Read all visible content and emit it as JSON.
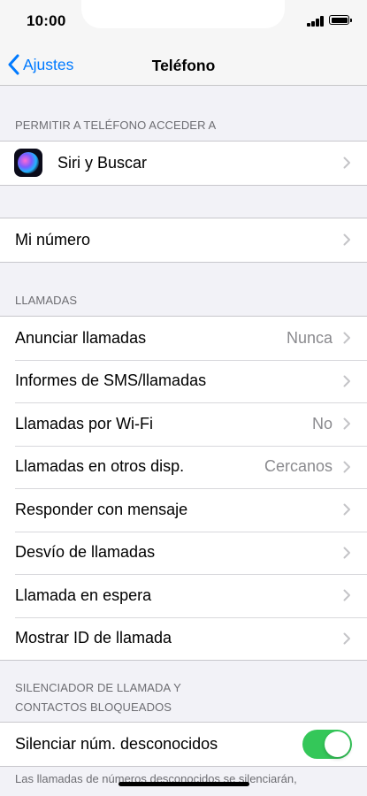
{
  "status_bar": {
    "time": "10:00"
  },
  "nav": {
    "back_label": "Ajustes",
    "title": "Teléfono"
  },
  "section_access": {
    "header": "PERMITIR A TELÉFONO ACCEDER A",
    "items": [
      {
        "label": "Siri y Buscar",
        "icon": "siri-icon"
      }
    ]
  },
  "section_number": {
    "items": [
      {
        "label": "Mi número"
      }
    ]
  },
  "section_calls": {
    "header": "LLAMADAS",
    "items": [
      {
        "label": "Anunciar llamadas",
        "value": "Nunca"
      },
      {
        "label": "Informes de SMS/llamadas",
        "value": ""
      },
      {
        "label": "Llamadas por Wi-Fi",
        "value": "No"
      },
      {
        "label": "Llamadas en otros disp.",
        "value": "Cercanos"
      },
      {
        "label": "Responder con mensaje",
        "value": ""
      },
      {
        "label": "Desvío de llamadas",
        "value": ""
      },
      {
        "label": "Llamada en espera",
        "value": ""
      },
      {
        "label": "Mostrar ID de llamada",
        "value": ""
      }
    ]
  },
  "section_silence": {
    "header_line1": "SILENCIADOR DE LLAMADA Y",
    "header_line2": "CONTACTOS BLOQUEADOS",
    "items": [
      {
        "label": "Silenciar núm. desconocidos",
        "toggle_on": true
      }
    ],
    "footer": "Las llamadas de números desconocidos se silenciarán,"
  },
  "colors": {
    "accent": "#007aff",
    "toggle_on": "#34c759",
    "background": "#f2f2f7"
  }
}
